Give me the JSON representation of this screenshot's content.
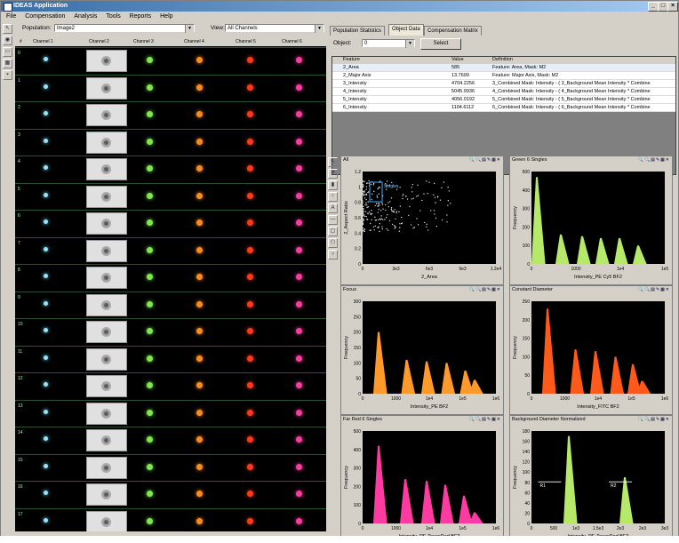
{
  "window": {
    "title": "IDEAS Application"
  },
  "menu": [
    "File",
    "Compensation",
    "Analysis",
    "Tools",
    "Reports",
    "Help"
  ],
  "population_bar": {
    "population_label": "Population:",
    "population_value": "Image2",
    "view_label": "View:",
    "view_value": "All Channels"
  },
  "gallery": {
    "hash": "#",
    "channels": [
      "Channel 1",
      "Channel 2",
      "Channel 3",
      "Channel 4",
      "Channel 5",
      "Channel 6"
    ],
    "row_numbers": [
      "0",
      "1",
      "2",
      "3",
      "4",
      "5",
      "6",
      "7",
      "8",
      "9",
      "10",
      "11",
      "12",
      "13",
      "14",
      "15",
      "16",
      "17"
    ],
    "row_count": 18
  },
  "tabs": [
    "Population Statistics",
    "Object Data",
    "Compensation Matrix"
  ],
  "object_data": {
    "object_label": "Object:",
    "object_value": "0",
    "select_button": "Select",
    "columns": [
      "Feature",
      "Value",
      "Definition"
    ],
    "rows": [
      {
        "feature": "2_Area",
        "value": "585",
        "definition": "Feature: Area, Mask: M2"
      },
      {
        "feature": "2_Major Axis",
        "value": "13.7699",
        "definition": "Feature: Major Axis, Mask: M2"
      },
      {
        "feature": "3_Intensity",
        "value": "4704.2256",
        "definition": "3_Combined Mask: Intensity - ( 3_Background Mean Intensity * Combine"
      },
      {
        "feature": "4_Intensity",
        "value": "5045.9936",
        "definition": "4_Combined Mask: Intensity - ( 4_Background Mean Intensity * Combine"
      },
      {
        "feature": "5_Intensity",
        "value": "4056.0192",
        "definition": "5_Combined Mask: Intensity - ( 5_Background Mean Intensity * Combine"
      },
      {
        "feature": "6_Intensity",
        "value": "1104.6112",
        "definition": "6_Combined Mask: Intensity - ( 6_Background Mean Intensity * Combine"
      }
    ]
  },
  "colors": {
    "green": "#7ee84a",
    "orange": "#ff8c1a",
    "red": "#ff3a1a",
    "pink": "#ff3aa0",
    "lime": "#b6e86a",
    "cyan": "#8fe6ff"
  },
  "chart_data": [
    {
      "type": "scatter",
      "title": "All",
      "gate_label": "Singles",
      "xlabel": "2_Area",
      "ylabel": "2_Aspect Ratio",
      "xlim": [
        0,
        12000
      ],
      "ylim": [
        0,
        1.2
      ],
      "x_ticks": [
        "0",
        "3e3",
        "6e3",
        "9e3",
        "1.2e4"
      ],
      "y_ticks": [
        "0",
        "0.2",
        "0.4",
        "0.6",
        "0.8",
        "1",
        "1.2"
      ]
    },
    {
      "type": "bar",
      "title": "Green 6 Singles",
      "xlabel": "Intensity_PE Cy5 BF2",
      "ylabel": "Frequency",
      "color": "#b6e86a",
      "ylim": [
        0,
        500
      ],
      "x_ticks": [
        "0",
        "1000",
        "1e4",
        "1e5"
      ],
      "y_ticks": [
        "0",
        "100",
        "200",
        "300",
        "400",
        "500"
      ],
      "peaks": [
        {
          "x": 0.04,
          "y": 470
        },
        {
          "x": 0.22,
          "y": 160
        },
        {
          "x": 0.38,
          "y": 150
        },
        {
          "x": 0.52,
          "y": 140
        },
        {
          "x": 0.66,
          "y": 140
        },
        {
          "x": 0.8,
          "y": 100
        }
      ]
    },
    {
      "type": "bar",
      "title": "Focus",
      "xlabel": "Intensity_PE BF2",
      "ylabel": "Frequency",
      "color": "#ff9a2a",
      "ylim": [
        0,
        300
      ],
      "x_ticks": [
        "0",
        "1000",
        "1e4",
        "1e5",
        "1e6"
      ],
      "y_ticks": [
        "0",
        "50",
        "100",
        "150",
        "200",
        "250",
        "300"
      ],
      "peaks": [
        {
          "x": 0.12,
          "y": 200
        },
        {
          "x": 0.33,
          "y": 110
        },
        {
          "x": 0.48,
          "y": 105
        },
        {
          "x": 0.63,
          "y": 100
        },
        {
          "x": 0.77,
          "y": 75
        },
        {
          "x": 0.84,
          "y": 45
        }
      ]
    },
    {
      "type": "bar",
      "title": "Constant Diameter",
      "xlabel": "Intensity_FITC BF2",
      "ylabel": "Frequency",
      "color": "#ff5a1a",
      "ylim": [
        0,
        250
      ],
      "x_ticks": [
        "0",
        "1000",
        "1e4",
        "1e5",
        "1e6"
      ],
      "y_ticks": [
        "0",
        "50",
        "100",
        "150",
        "200",
        "250"
      ],
      "peaks": [
        {
          "x": 0.12,
          "y": 230
        },
        {
          "x": 0.33,
          "y": 120
        },
        {
          "x": 0.48,
          "y": 115
        },
        {
          "x": 0.63,
          "y": 100
        },
        {
          "x": 0.76,
          "y": 80
        },
        {
          "x": 0.83,
          "y": 35
        }
      ]
    },
    {
      "type": "bar",
      "title": "Far Red 6 Singles",
      "xlabel": "Intensity_PE-TexasRed BF2",
      "ylabel": "Frequency",
      "color": "#ff3aa0",
      "ylim": [
        0,
        500
      ],
      "x_ticks": [
        "0",
        "1000",
        "1e4",
        "1e5",
        "1e6"
      ],
      "y_ticks": [
        "0",
        "100",
        "200",
        "300",
        "400",
        "500"
      ],
      "peaks": [
        {
          "x": 0.12,
          "y": 420
        },
        {
          "x": 0.32,
          "y": 240
        },
        {
          "x": 0.48,
          "y": 230
        },
        {
          "x": 0.62,
          "y": 210
        },
        {
          "x": 0.76,
          "y": 150
        },
        {
          "x": 0.84,
          "y": 60
        }
      ]
    },
    {
      "type": "bar",
      "title": "Background Diameter Normalized",
      "xlabel": "Intensity_PE-TexasRed BF2",
      "ylabel": "Frequency",
      "color": "#b6e86a",
      "ylim": [
        0,
        180
      ],
      "x_ticks": [
        "0",
        "500",
        "1e3",
        "1.5e3",
        "2e3",
        "2e3",
        "3e3"
      ],
      "y_ticks": [
        "0",
        "20",
        "40",
        "60",
        "80",
        "100",
        "120",
        "140",
        "160",
        "180"
      ],
      "gate_labels": [
        "R1",
        "R2"
      ],
      "peaks": [
        {
          "x": 0.28,
          "y": 170
        },
        {
          "x": 0.7,
          "y": 90
        }
      ]
    }
  ]
}
